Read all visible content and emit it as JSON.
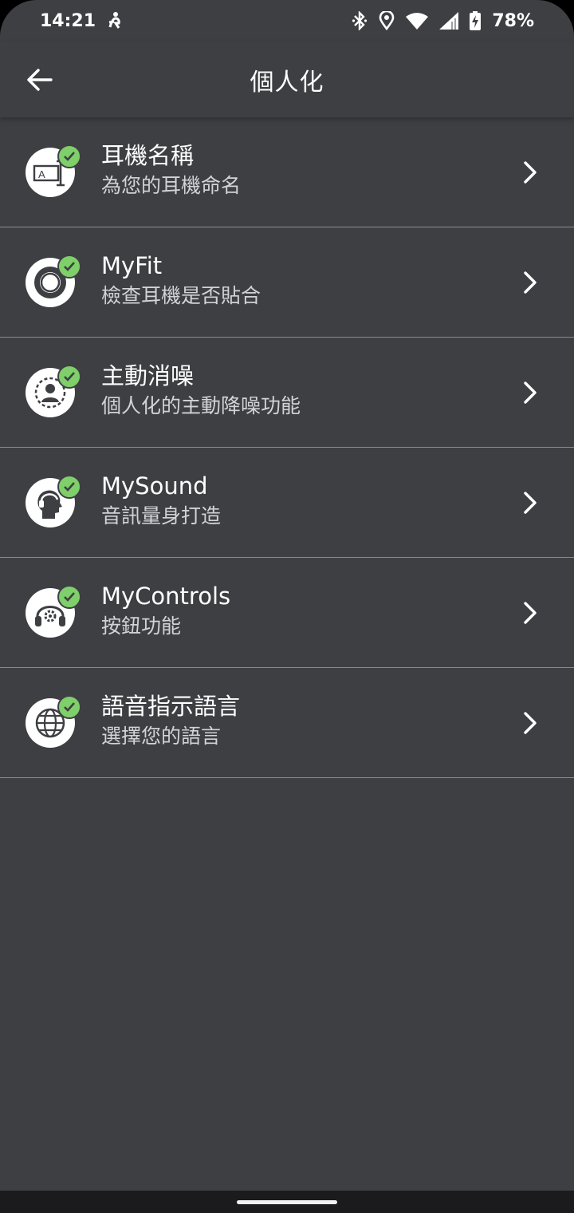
{
  "status_bar": {
    "time": "14:21",
    "battery": "78%"
  },
  "header": {
    "title": "個人化"
  },
  "items": [
    {
      "title": "耳機名稱",
      "subtitle": "為您的耳機命名",
      "icon": "rename-icon"
    },
    {
      "title": "MyFit",
      "subtitle": "檢查耳機是否貼合",
      "icon": "fit-icon"
    },
    {
      "title": "主動消噪",
      "subtitle": "個人化的主動降噪功能",
      "icon": "anc-icon"
    },
    {
      "title": "MySound",
      "subtitle": "音訊量身打造",
      "icon": "mysound-icon"
    },
    {
      "title": "MyControls",
      "subtitle": "按鈕功能",
      "icon": "controls-icon"
    },
    {
      "title": "語音指示語言",
      "subtitle": "選擇您的語言",
      "icon": "globe-icon"
    }
  ],
  "colors": {
    "background": "#3e3f43",
    "check": "#7fcf6a",
    "divider": "#8a8b8f"
  }
}
